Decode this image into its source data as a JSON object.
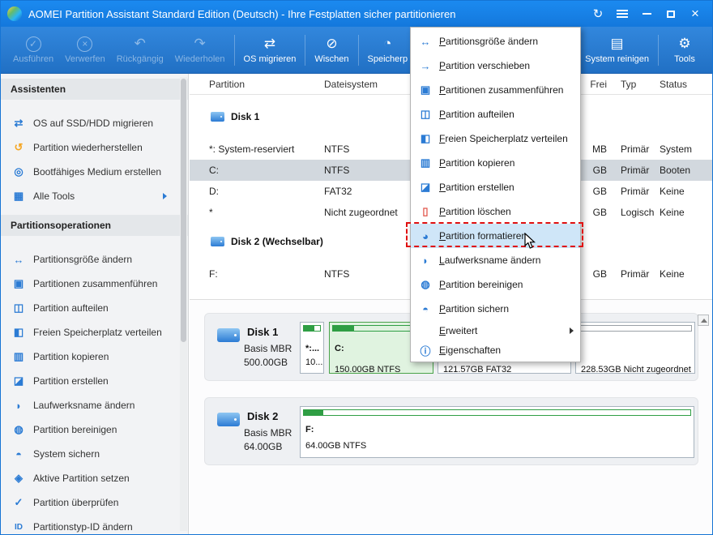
{
  "colors": {
    "titlebar_blue": "#1478dc",
    "toolbar_blue": "#2170c4",
    "accent_blue": "#2b7bd4",
    "selected_row": "#d2d8de",
    "ntfs_green": "#2f9e44",
    "selected_block_green": "#e0f3e0",
    "menu_highlight": "#cfe6f8",
    "annotation_red": "#e01010",
    "sidebar_bg": "#f2f3f5"
  },
  "title_bar": {
    "title": "AOMEI Partition Assistant Standard Edition (Deutsch) - Ihre Festplatten sicher partitionieren",
    "refresh_glyph": "↻",
    "close_glyph": "×"
  },
  "toolbar": {
    "buttons": [
      {
        "label": "Ausführen",
        "glyph": "✓",
        "enabled": false
      },
      {
        "label": "Verwerfen",
        "glyph": "×",
        "enabled": false
      },
      {
        "label": "Rückgängig",
        "glyph": "↶",
        "enabled": false
      },
      {
        "label": "Wiederholen",
        "glyph": "↷",
        "enabled": false
      },
      {
        "label": "OS migrieren",
        "glyph": "⇄",
        "enabled": true
      },
      {
        "label": "Wischen",
        "glyph": "⊘",
        "enabled": true
      },
      {
        "label": "Speicherp",
        "glyph": "◔",
        "enabled": true
      },
      {
        "label": "System reinigen",
        "glyph": "▤",
        "enabled": true
      },
      {
        "label": "Tools",
        "glyph": "⚙",
        "enabled": true
      }
    ]
  },
  "sidebar": {
    "sections": [
      {
        "header": "Assistenten",
        "items": [
          {
            "label": "OS auf SSD/HDD migrieren",
            "glyph": "⇄"
          },
          {
            "label": "Partition wiederherstellen",
            "glyph": "↺"
          },
          {
            "label": "Bootfähiges Medium erstellen",
            "glyph": "◎"
          },
          {
            "label": "Alle Tools",
            "glyph": "▦"
          }
        ]
      },
      {
        "header": "Partitionsoperationen",
        "items": [
          {
            "label": "Partitionsgröße ändern",
            "glyph": "↔"
          },
          {
            "label": "Partitionen zusammenführen",
            "glyph": "▣"
          },
          {
            "label": "Partition aufteilen",
            "glyph": "◫"
          },
          {
            "label": "Freien Speicherplatz verteilen",
            "glyph": "◧"
          },
          {
            "label": "Partition kopieren",
            "glyph": "▥"
          },
          {
            "label": "Partition erstellen",
            "glyph": "◪"
          },
          {
            "label": "Laufwerksname ändern",
            "glyph": "◗"
          },
          {
            "label": "Partition bereinigen",
            "glyph": "◍"
          },
          {
            "label": "System sichern",
            "glyph": "◓"
          },
          {
            "label": "Aktive Partition setzen",
            "glyph": "◈"
          },
          {
            "label": "Partition überprüfen",
            "glyph": "✓"
          },
          {
            "label": "Partitionstyp-ID ändern",
            "glyph": "ID"
          }
        ]
      }
    ]
  },
  "table": {
    "columns": {
      "partition": "Partition",
      "filesystem": "Dateisystem",
      "free": "Frei",
      "type": "Typ",
      "status": "Status"
    },
    "disk1": {
      "title": "Disk 1",
      "rows": [
        {
          "partition": "*: System-reserviert",
          "fs": "NTFS",
          "free": "MB",
          "type": "Primär",
          "status": "System"
        },
        {
          "partition": "C:",
          "fs": "NTFS",
          "free": "GB",
          "type": "Primär",
          "status": "Booten"
        },
        {
          "partition": "D:",
          "fs": "FAT32",
          "free": "GB",
          "type": "Primär",
          "status": "Keine"
        },
        {
          "partition": "*",
          "fs": "Nicht zugeordnet",
          "free": "GB",
          "type": "Logisch",
          "status": "Keine"
        }
      ]
    },
    "disk2": {
      "title": "Disk 2 (Wechselbar)",
      "rows": [
        {
          "partition": "F:",
          "fs": "NTFS",
          "free": "GB",
          "type": "Primär",
          "status": "Keine"
        }
      ]
    }
  },
  "context_menu": {
    "items": [
      {
        "label": "Partitionsgröße ändern",
        "glyph": "↔"
      },
      {
        "label": "Partition verschieben",
        "glyph": "→"
      },
      {
        "label": "Partitionen zusammenführen",
        "glyph": "▣"
      },
      {
        "label": "Partition aufteilen",
        "glyph": "◫"
      },
      {
        "label": "Freien Speicherplatz verteilen",
        "glyph": "◧"
      },
      {
        "label": "Partition kopieren",
        "glyph": "▥"
      },
      {
        "label": "Partition erstellen",
        "glyph": "◪"
      },
      {
        "label": "Partition löschen",
        "glyph": "▯"
      },
      {
        "label": "Partition formatieren",
        "glyph": "◕",
        "highlighted": true
      },
      {
        "label": "Laufwerksname ändern",
        "glyph": "◗"
      },
      {
        "label": "Partition bereinigen",
        "glyph": "◍"
      },
      {
        "label": "Partition sichern",
        "glyph": "◓"
      },
      {
        "label": "Erweitert",
        "glyph": "",
        "submenu": true
      },
      {
        "label": "Eigenschaften",
        "glyph": "ⓘ"
      }
    ]
  },
  "disk_panel": {
    "disks": [
      {
        "name": "Disk 1",
        "bus": "Basis MBR",
        "size": "500.00GB",
        "partitions": [
          {
            "line1": "*:...",
            "line2": "10...",
            "fill_percent": 65
          },
          {
            "line1": "C:",
            "line2": "150.00GB NTFS",
            "fill_percent": 22,
            "selected": true
          },
          {
            "line1": "",
            "line2": "121.57GB FAT32",
            "fill_percent": 12
          },
          {
            "line1": "",
            "line2": "228.53GB Nicht zugeordnet",
            "unallocated": true
          }
        ]
      },
      {
        "name": "Disk 2",
        "bus": "Basis MBR",
        "size": "64.00GB",
        "partitions": [
          {
            "line1": "F:",
            "line2": "64.00GB NTFS",
            "fill_percent": 5
          }
        ]
      }
    ]
  }
}
